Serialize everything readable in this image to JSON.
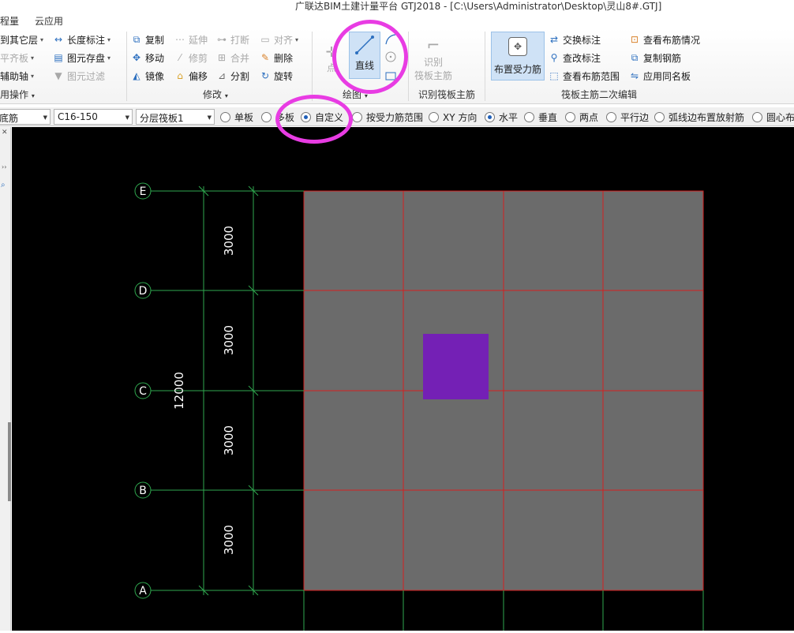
{
  "window": {
    "title": "广联达BIM土建计量平台 GTJ2018 - [C:\\Users\\Administrator\\Desktop\\灵山8#.GTJ]"
  },
  "menu": {
    "items": [
      "程量",
      "云应用"
    ]
  },
  "ribbon": {
    "layer_group": {
      "copy_to_other_layer": "到其它层",
      "align": "平齐板",
      "aux_axis": "辅助轴",
      "group_label": "用操作"
    },
    "common_group": {
      "length_dim": "长度标注",
      "element_save": "图元存盘",
      "element_filter": "图元过滤"
    },
    "modify_group": {
      "copy": "复制",
      "extend": "延伸",
      "break": "打断",
      "align": "对齐",
      "move": "移动",
      "trim": "修剪",
      "merge": "合并",
      "delete": "删除",
      "mirror": "镜像",
      "offset": "偏移",
      "split": "分割",
      "rotate": "旋转",
      "group_label": "修改"
    },
    "draw_group": {
      "point": "点",
      "line": "直线",
      "group_label": "绘图"
    },
    "identify_group": {
      "identify_line1": "识别",
      "identify_line2": "筏板主筋",
      "group_label": "识别筏板主筋"
    },
    "raft_group": {
      "place_rebar": "布置受力筋",
      "swap_label": "交换标注",
      "change_label": "查改标注",
      "view_range": "查看布筋范围",
      "view_layout": "查看布筋情况",
      "copy_rebar": "复制钢筋",
      "apply_same": "应用同名板",
      "group_label": "筏板主筋二次编辑"
    }
  },
  "options": {
    "combo1": "底筋",
    "combo2": "C16-150",
    "combo3": "分层筏板1",
    "radios": [
      {
        "label": "单板",
        "checked": false
      },
      {
        "label": "多板",
        "checked": false
      },
      {
        "label": "自定义",
        "checked": true
      },
      {
        "label": "按受力筋范围",
        "checked": false
      },
      {
        "label": "XY 方向",
        "checked": false
      },
      {
        "label": "水平",
        "checked": true
      },
      {
        "label": "垂直",
        "checked": false
      },
      {
        "label": "两点",
        "checked": false
      },
      {
        "label": "平行边",
        "checked": false
      },
      {
        "label": "弧线边布置放射筋",
        "checked": false
      },
      {
        "label": "圆心布",
        "checked": false
      }
    ]
  },
  "drawing": {
    "axes": [
      "E",
      "D",
      "C",
      "B",
      "A"
    ],
    "segment_dims": [
      "3000",
      "3000",
      "3000",
      "3000"
    ],
    "total_dim": "12000",
    "colors": {
      "background": "#000000",
      "slab_fill": "#6b6b6b",
      "grid_red": "#d42020",
      "axis_green": "#2fa84f",
      "column_purple": "#7420b5",
      "highlight": "#e83ce3"
    }
  }
}
